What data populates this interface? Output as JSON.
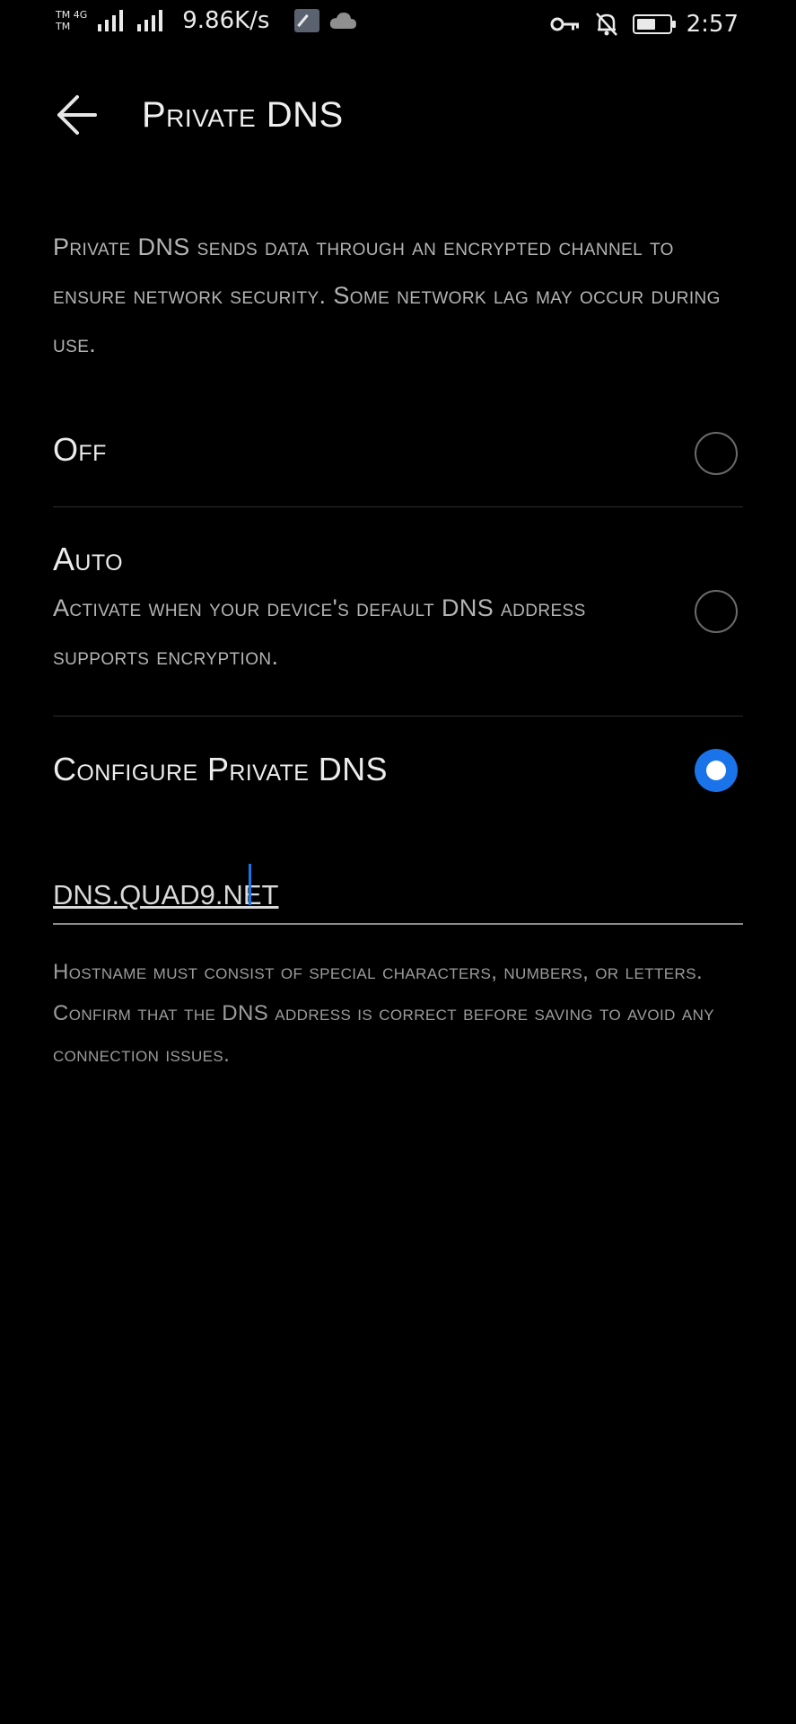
{
  "status_bar": {
    "carrier_top": "TM 4G",
    "carrier_bottom": "TM",
    "net_speed": "9.86K/s",
    "time": "2:57",
    "icons": [
      "signal-icon",
      "signal-icon",
      "download-icon",
      "cloud-icon",
      "vpn-key-icon",
      "bell-off-icon",
      "battery-icon"
    ]
  },
  "header": {
    "back_icon": "arrow-left-icon",
    "title": "Private DNS"
  },
  "description": "Private DNS sends data through an encrypted channel to ensure network security. Some network lag may occur during use.",
  "options": [
    {
      "title": "Off",
      "subtitle": "",
      "selected": false
    },
    {
      "title": "Auto",
      "subtitle": "Activate when your device's default DNS address supports encryption.",
      "selected": false
    },
    {
      "title": "Configure Private DNS",
      "subtitle": "",
      "selected": true
    }
  ],
  "dns_field": {
    "value": "dns.quad9.net"
  },
  "hint": "Hostname must consist of special characters, numbers, or letters. Confirm that the DNS address is correct before saving to avoid any connection issues.",
  "colors": {
    "background": "#000000",
    "accent": "#1a73e8"
  }
}
